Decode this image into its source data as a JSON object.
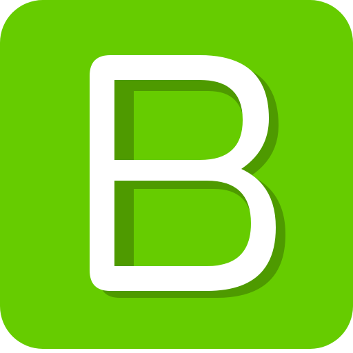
{
  "app_icon": {
    "letter": "B",
    "colors": {
      "background": "#66CC00",
      "letter": "#FFFFFF",
      "shadow": "#4E9A00"
    },
    "icon_name": "letter-b-app-icon"
  }
}
